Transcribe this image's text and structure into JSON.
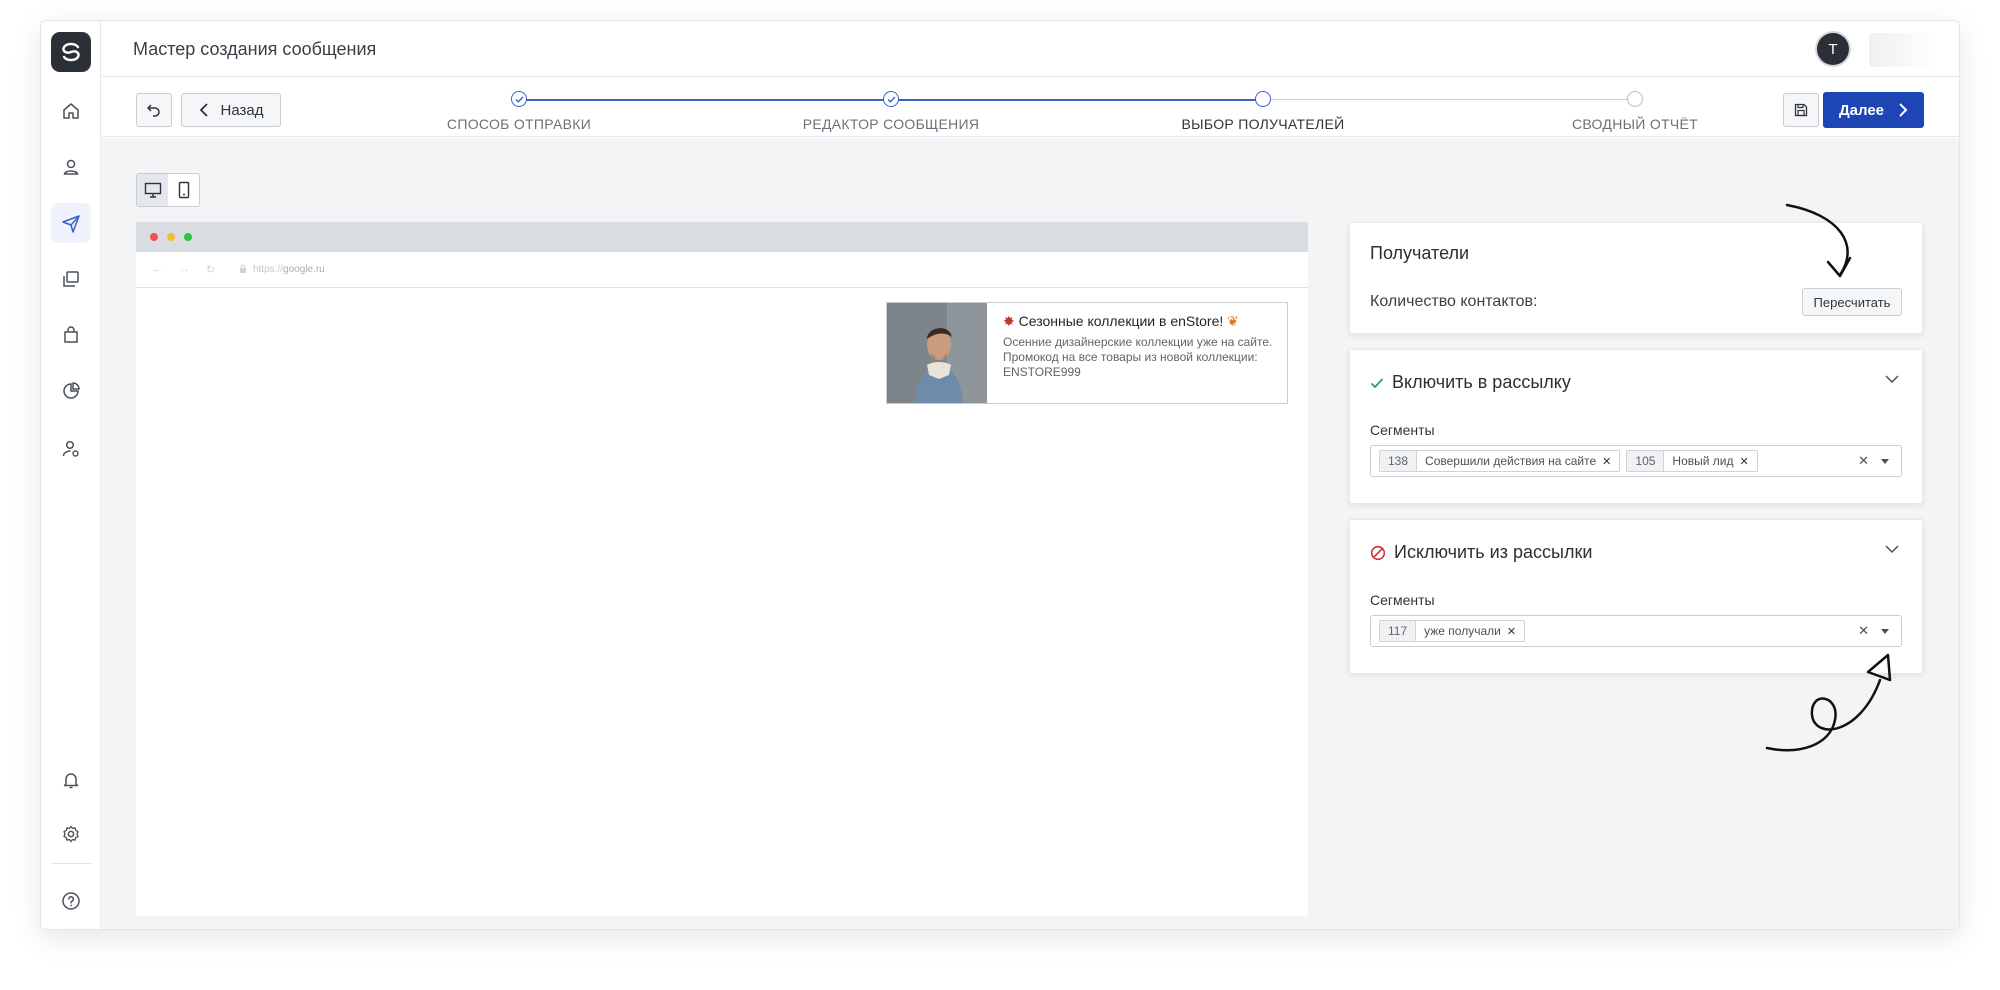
{
  "header": {
    "title": "Мастер создания сообщения",
    "avatar_initial": "T"
  },
  "sidebar": {
    "items": [
      {
        "name": "home-icon"
      },
      {
        "name": "user-icon"
      },
      {
        "name": "send-icon",
        "active": true
      },
      {
        "name": "copy-icon"
      },
      {
        "name": "bag-icon"
      },
      {
        "name": "pie-chart-icon"
      },
      {
        "name": "user-settings-icon"
      }
    ],
    "bottom": [
      {
        "name": "bell-icon"
      },
      {
        "name": "gear-icon"
      },
      {
        "name": "help-icon"
      }
    ]
  },
  "wizard": {
    "back_label": "Назад",
    "next_label": "Далее",
    "steps": [
      {
        "label": "СПОСОБ ОТПРАВКИ",
        "state": "done"
      },
      {
        "label": "РЕДАКТОР СООБЩЕНИЯ",
        "state": "done"
      },
      {
        "label": "ВЫБОР ПОЛУЧАТЕЛЕЙ",
        "state": "current"
      },
      {
        "label": "СВОДНЫЙ ОТЧЁТ",
        "state": "todo"
      }
    ]
  },
  "preview": {
    "url_prefix": "https://",
    "url_host": "google.ru",
    "popup": {
      "title": "Сезонные коллекции в enStore!",
      "text": "Осенние дизайнерские коллекции уже на сайте. Промокод на все товары из новой коллекции: ENSTORE999"
    }
  },
  "recipients": {
    "title": "Получатели",
    "count_label": "Количество контактов:",
    "recalc_label": "Пересчитать"
  },
  "include": {
    "title": "Включить в рассылку",
    "segments_label": "Сегменты",
    "tags": [
      {
        "count": "138",
        "name": "Совершили действия на сайте"
      },
      {
        "count": "105",
        "name": "Новый лид"
      }
    ]
  },
  "exclude": {
    "title": "Исключить из рассылки",
    "segments_label": "Сегменты",
    "tags": [
      {
        "count": "117",
        "name": "уже получали"
      }
    ]
  },
  "colors": {
    "primary": "#1d46b4",
    "include_check": "#2e9e5b",
    "exclude_icon": "#d3302f"
  }
}
